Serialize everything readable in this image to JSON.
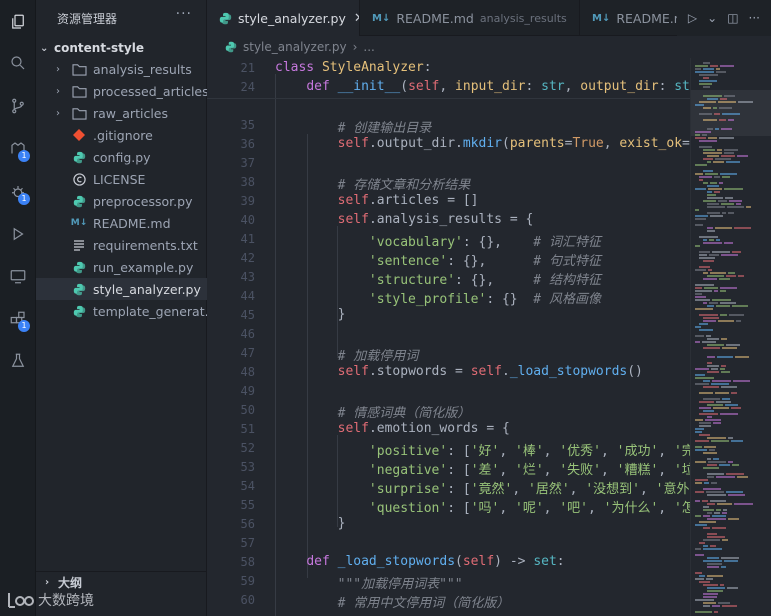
{
  "sidebar": {
    "title": "资源管理器",
    "more": "···",
    "project": "content-style",
    "items": [
      {
        "label": "analysis_results",
        "kind": "folder"
      },
      {
        "label": "processed_articles",
        "kind": "folder"
      },
      {
        "label": "raw_articles",
        "kind": "folder"
      },
      {
        "label": ".gitignore",
        "kind": "git"
      },
      {
        "label": "config.py",
        "kind": "py"
      },
      {
        "label": "LICENSE",
        "kind": "license"
      },
      {
        "label": "preprocessor.py",
        "kind": "py"
      },
      {
        "label": "README.md",
        "kind": "md"
      },
      {
        "label": "requirements.txt",
        "kind": "txt"
      },
      {
        "label": "run_example.py",
        "kind": "py"
      },
      {
        "label": "style_analyzer.py",
        "kind": "py",
        "selected": true
      },
      {
        "label": "template_generat...",
        "kind": "py"
      }
    ],
    "outline": "大纲"
  },
  "activity_badges": [
    "1",
    "1",
    "1"
  ],
  "tabs": [
    {
      "label": "style_analyzer.py",
      "close": "✕",
      "active": true
    },
    {
      "label": "README.md",
      "desc": "analysis_results"
    },
    {
      "label": "README.md"
    }
  ],
  "breadcrumb": {
    "file": "style_analyzer.py",
    "rest": "..."
  },
  "code_lines": [
    {
      "n": "21",
      "html": "<span class='kw'>class</span> <span class='cls'>StyleAnalyzer</span>:"
    },
    {
      "n": "24",
      "html": "    <span class='kw'>def</span> <span class='fn'>__init__</span>(<span class='sf'>self</span>, <span class='pa'>input_dir</span>: <span class='ty'>str</span>, <span class='pa'>output_dir</span>: <span class='ty'>str</span>"
    },
    {
      "n": "",
      "html": ""
    },
    {
      "n": "35",
      "html": "        <span class='cm'># 创建输出目录</span>"
    },
    {
      "n": "36",
      "html": "        <span class='sf'>self</span>.output_dir.<span class='fn'>mkdir</span>(<span class='pa'>parents</span>=<span class='bo'>True</span>, <span class='pa'>exist_ok</span>=<span class='bo'>T</span>"
    },
    {
      "n": "37",
      "html": ""
    },
    {
      "n": "38",
      "html": "        <span class='cm'># 存储文章和分析结果</span>"
    },
    {
      "n": "39",
      "html": "        <span class='sf'>self</span>.articles = []"
    },
    {
      "n": "40",
      "html": "        <span class='sf'>self</span>.analysis_results = {"
    },
    {
      "n": "41",
      "html": "            <span class='st'>'vocabulary'</span>: {},    <span class='cm'># 词汇特征</span>"
    },
    {
      "n": "42",
      "html": "            <span class='st'>'sentence'</span>: {},      <span class='cm'># 句式特征</span>"
    },
    {
      "n": "43",
      "html": "            <span class='st'>'structure'</span>: {},     <span class='cm'># 结构特征</span>"
    },
    {
      "n": "44",
      "html": "            <span class='st'>'style_profile'</span>: {}  <span class='cm'># 风格画像</span>"
    },
    {
      "n": "45",
      "html": "        }"
    },
    {
      "n": "46",
      "html": ""
    },
    {
      "n": "47",
      "html": "        <span class='cm'># 加载停用词</span>"
    },
    {
      "n": "48",
      "html": "        <span class='sf'>self</span>.stopwords = <span class='sf'>self</span>.<span class='fn'>_load_stopwords</span>()"
    },
    {
      "n": "49",
      "html": ""
    },
    {
      "n": "50",
      "html": "        <span class='cm'># 情感词典（简化版）</span>"
    },
    {
      "n": "51",
      "html": "        <span class='sf'>self</span>.emotion_words = {"
    },
    {
      "n": "52",
      "html": "            <span class='st'>'positive'</span>: [<span class='st'>'好'</span>, <span class='st'>'棒'</span>, <span class='st'>'优秀'</span>, <span class='st'>'成功'</span>, <span class='st'>'完</span>"
    },
    {
      "n": "53",
      "html": "            <span class='st'>'negative'</span>: [<span class='st'>'差'</span>, <span class='st'>'烂'</span>, <span class='st'>'失败'</span>, <span class='st'>'糟糕'</span>, <span class='st'>'垃</span>"
    },
    {
      "n": "54",
      "html": "            <span class='st'>'surprise'</span>: [<span class='st'>'竟然'</span>, <span class='st'>'居然'</span>, <span class='st'>'没想到'</span>, <span class='st'>'意外</span>"
    },
    {
      "n": "55",
      "html": "            <span class='st'>'question'</span>: [<span class='st'>'吗'</span>, <span class='st'>'呢'</span>, <span class='st'>'吧'</span>, <span class='st'>'为什么'</span>, <span class='st'>'怎</span>"
    },
    {
      "n": "56",
      "html": "        }"
    },
    {
      "n": "57",
      "html": ""
    },
    {
      "n": "58",
      "html": "    <span class='kw'>def</span> <span class='fn'>_load_stopwords</span>(<span class='sf'>self</span>) -&gt; <span class='ty'>set</span>:"
    },
    {
      "n": "59",
      "html": "        <span class='cm'>\"\"\"加载停用词表\"\"\"</span>"
    },
    {
      "n": "60",
      "html": "        <span class='cm'># 常用中文停用词（简化版）</span>"
    }
  ],
  "watermark": "大数跨境",
  "colors": {
    "accent": "#3b82f6",
    "python": "#4ec9b0",
    "git": "#f05032",
    "md": "#519aba"
  }
}
